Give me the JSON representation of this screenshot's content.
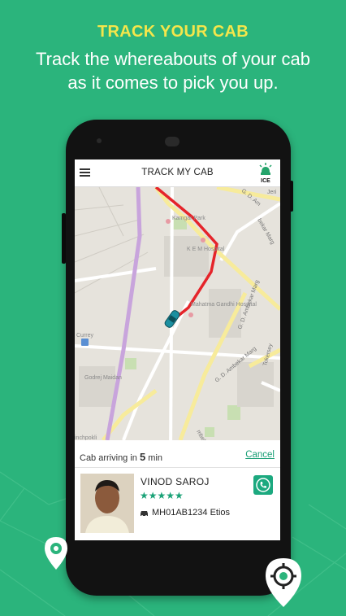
{
  "promo": {
    "title": "TRACK YOUR CAB",
    "subtitle": "Track the whereabouts of your cab as it comes to pick you up."
  },
  "app": {
    "title": "TRACK MY CAB",
    "ice_label": "ICE"
  },
  "map": {
    "labels": {
      "kamgar_park": "Kamgar Park",
      "kem_hospital": "K E M Hospital",
      "mahatma_gandhi_hospital": "Mahatma Gandhi Hospital",
      "curry": "Currey",
      "godrej_maidan": "Godrej Maidan",
      "ambekar_marg_1": "G. D. Ambekar Marg",
      "ambekar_marg_2": "G. D. Ambekar Marg",
      "ambekar_marg_3": "mbekar Marg",
      "gd_top": "G. D. Am",
      "bekar_marg_top": "bekar Marg",
      "jeri": "Jeri",
      "chinchpokli": "inchpokli",
      "tokersey": "Tokersey"
    }
  },
  "eta": {
    "prefix": "Cab arriving in",
    "minutes": "5",
    "unit": "min",
    "cancel_label": "Cancel"
  },
  "driver": {
    "name": "VINOD SAROJ",
    "stars": "★★★★★",
    "rating": 5,
    "vehicle_number": "MH01AB1234",
    "vehicle_model": "Etios"
  },
  "colors": {
    "background": "#2bb47c",
    "accent_yellow": "#f4e64b",
    "route": "#e5242a",
    "app_green": "#1aa277"
  }
}
